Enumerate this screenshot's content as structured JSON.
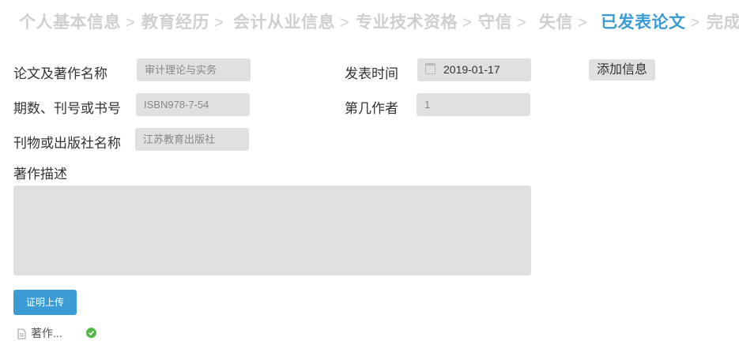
{
  "steps": [
    {
      "label": "个人基本信息",
      "state": "done"
    },
    {
      "label": "教育经历",
      "state": "done"
    },
    {
      "label": "会计从业信息",
      "state": "done"
    },
    {
      "label": "专业技术资格",
      "state": "done"
    },
    {
      "label": "守信",
      "state": "done"
    },
    {
      "label": "失信",
      "state": "done"
    },
    {
      "label": "已发表论文",
      "state": "active"
    },
    {
      "label": "完成",
      "state": "pending"
    }
  ],
  "step_separator": ">",
  "form": {
    "title_label": "论文及著作名称",
    "title_value": "审计理论与实务",
    "publish_time_label": "发表时间",
    "publish_time_value": "2019-01-17",
    "issue_label": "期数、刊号或书号",
    "issue_value": "ISBN978-7-54",
    "author_rank_label": "第几作者",
    "author_rank_value": "1",
    "publisher_label": "刊物或出版社名称",
    "publisher_value": "江苏教育出版社",
    "description_label": "著作描述",
    "description_value": ""
  },
  "buttons": {
    "add_info": "添加信息",
    "upload_proof": "证明上传"
  },
  "attachments": [
    {
      "name": "著作...",
      "status": "uploaded"
    }
  ],
  "colors": {
    "active_step": "#3a9bd5",
    "inactive_step": "#cfcfcf",
    "upload_button": "#3a9bd5",
    "success": "#55b948",
    "field_bg": "#e0e0e0"
  }
}
